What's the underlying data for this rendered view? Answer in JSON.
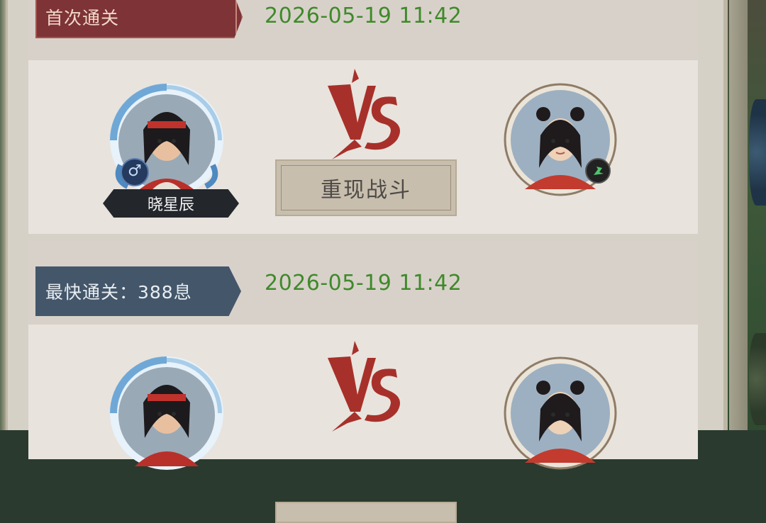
{
  "records": [
    {
      "tag_label": "首次通关",
      "timestamp": "2026-05-19 11:42",
      "player_name": "晓星辰",
      "gender_symbol": "♂",
      "replay_label": "重现战斗"
    },
    {
      "tag_label": "最快通关：388息",
      "timestamp": "2026-05-19 11:42"
    }
  ],
  "colors": {
    "first_tag": "#7e3336",
    "fastest_tag": "#44566a",
    "timestamp": "#3f8a2a",
    "vs": "#a8302a"
  }
}
